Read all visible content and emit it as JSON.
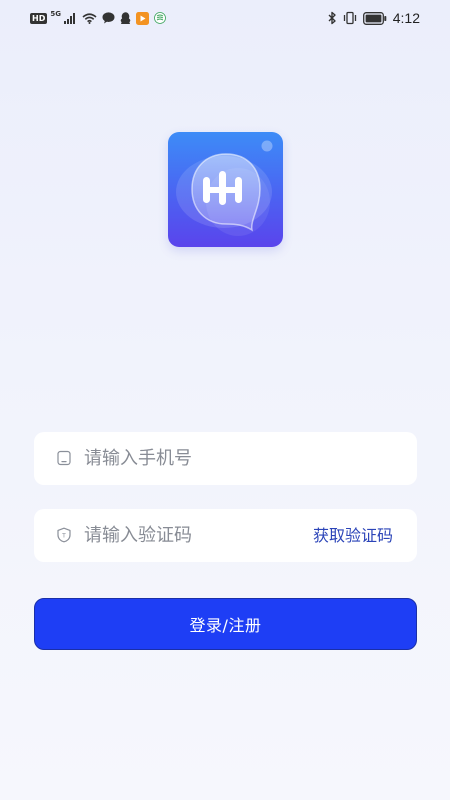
{
  "status_bar": {
    "hd_badge": "HD",
    "network_label": "5G",
    "clock": "4:12",
    "icons": [
      "signal-icon",
      "wifi-icon",
      "chat-bubble-icon",
      "qq-penguin-icon",
      "video-app-icon",
      "mobile-app-icon",
      "bluetooth-icon",
      "vibrate-icon",
      "battery-icon"
    ]
  },
  "logo": {
    "icon": "app-logo-icon",
    "colors": {
      "gradient_top": "#3d8cf7",
      "gradient_bottom": "#5a44ec",
      "glyph": "#ffffff"
    }
  },
  "form": {
    "phone": {
      "icon": "phone-icon",
      "placeholder": "请输入手机号",
      "value": ""
    },
    "code": {
      "icon": "shield-icon",
      "placeholder": "请输入验证码",
      "value": "",
      "get_code_label": "获取验证码"
    },
    "submit_label": "登录/注册"
  },
  "colors": {
    "accent": "#1e3ef5",
    "link": "#2b44b8",
    "placeholder": "#888c95"
  }
}
